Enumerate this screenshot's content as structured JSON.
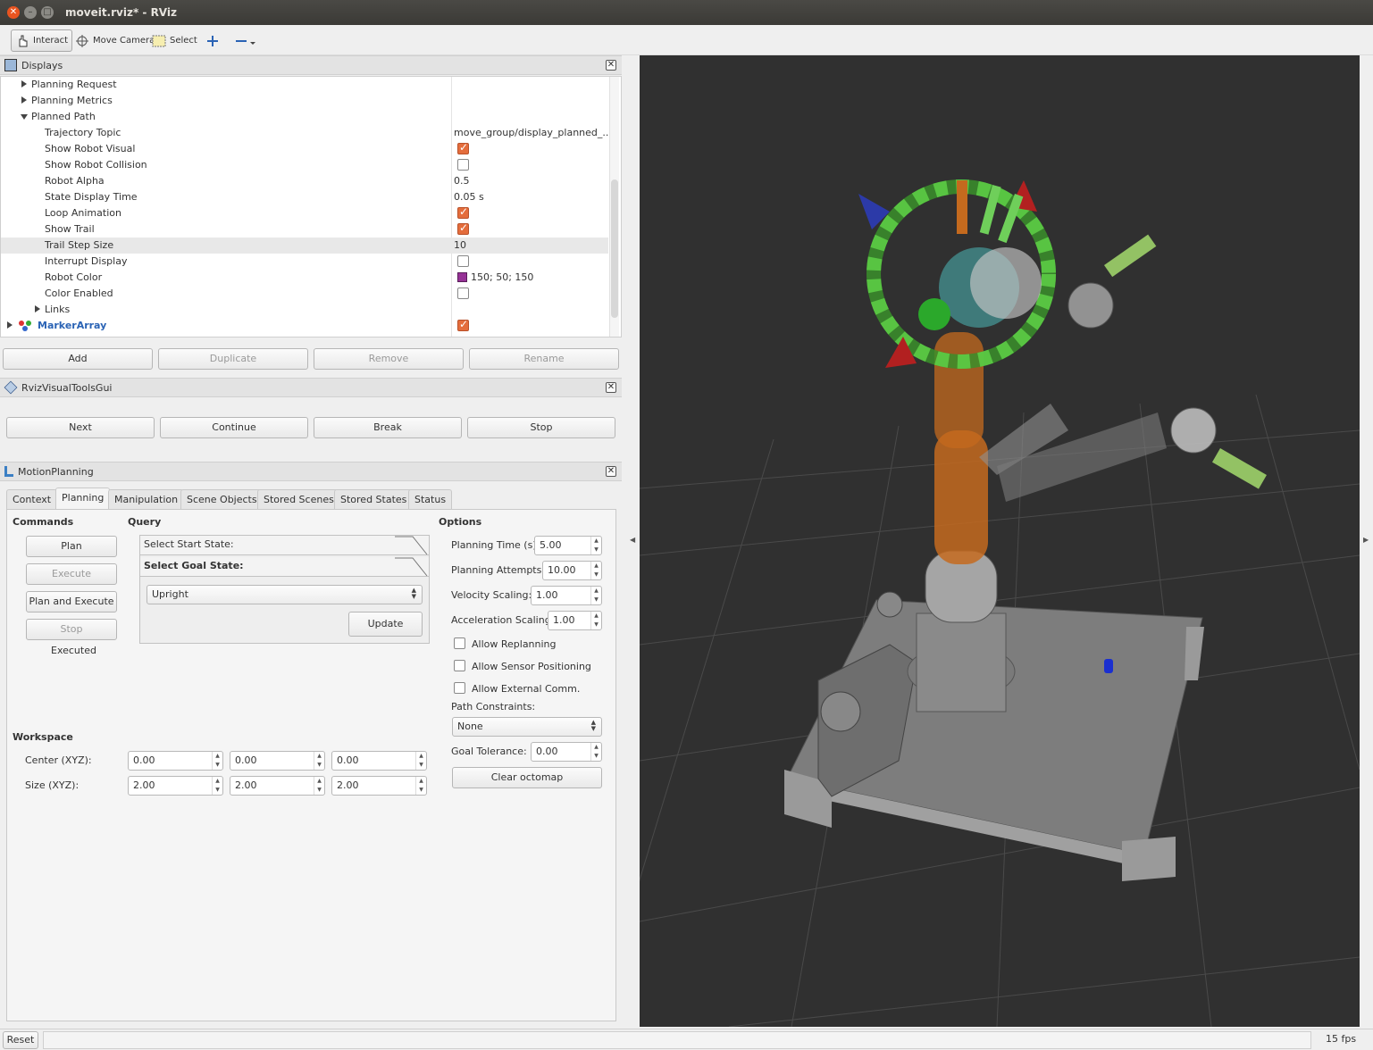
{
  "window": {
    "title": "moveit.rviz* - RViz"
  },
  "toolbar": {
    "interact": "Interact",
    "move_camera": "Move Camera",
    "select": "Select"
  },
  "displays": {
    "title": "Displays",
    "rows": [
      {
        "label": "Planning Request",
        "value": ""
      },
      {
        "label": "Planning Metrics",
        "value": ""
      },
      {
        "label": "Planned Path",
        "value": ""
      },
      {
        "label": "Trajectory Topic",
        "value": "move_group/display_planned_..."
      },
      {
        "label": "Show Robot Visual",
        "value": ""
      },
      {
        "label": "Show Robot Collision",
        "value": ""
      },
      {
        "label": "Robot Alpha",
        "value": "0.5"
      },
      {
        "label": "State Display Time",
        "value": "0.05 s"
      },
      {
        "label": "Loop Animation",
        "value": ""
      },
      {
        "label": "Show Trail",
        "value": ""
      },
      {
        "label": "Trail Step Size",
        "value": "10"
      },
      {
        "label": "Interrupt Display",
        "value": ""
      },
      {
        "label": "Robot Color",
        "value": "150; 50; 150"
      },
      {
        "label": "Color Enabled",
        "value": ""
      },
      {
        "label": "Links",
        "value": ""
      },
      {
        "label": "MarkerArray",
        "value": ""
      }
    ],
    "robot_color_hex": "#963296",
    "buttons": {
      "add": "Add",
      "duplicate": "Duplicate",
      "remove": "Remove",
      "rename": "Rename"
    }
  },
  "rvt": {
    "title": "RvizVisualToolsGui",
    "buttons": {
      "next": "Next",
      "continue": "Continue",
      "break": "Break",
      "stop": "Stop"
    }
  },
  "motion": {
    "title": "MotionPlanning",
    "tabs": [
      "Context",
      "Planning",
      "Manipulation",
      "Scene Objects",
      "Stored Scenes",
      "Stored States",
      "Status"
    ],
    "commands": {
      "heading": "Commands",
      "plan": "Plan",
      "execute": "Execute",
      "plan_execute": "Plan and Execute",
      "stop": "Stop",
      "status": "Executed"
    },
    "query": {
      "heading": "Query",
      "start": "Select Start State:",
      "goal": "Select Goal State:",
      "goal_value": "Upright",
      "update": "Update"
    },
    "options": {
      "heading": "Options",
      "planning_time_label": "Planning Time (s):",
      "planning_time": "5.00",
      "attempts_label": "Planning Attempts:",
      "attempts": "10.00",
      "velocity_label": "Velocity Scaling:",
      "velocity": "1.00",
      "accel_label": "Acceleration Scaling:",
      "accel": "1.00",
      "replanning": "Allow Replanning",
      "sensor": "Allow Sensor Positioning",
      "external": "Allow External Comm.",
      "constraints_label": "Path Constraints:",
      "constraints": "None",
      "tolerance_label": "Goal Tolerance:",
      "tolerance": "0.00",
      "clear": "Clear octomap"
    },
    "workspace": {
      "heading": "Workspace",
      "center_label": "Center (XYZ):",
      "center": [
        "0.00",
        "0.00",
        "0.00"
      ],
      "size_label": "Size (XYZ):",
      "size": [
        "2.00",
        "2.00",
        "2.00"
      ]
    }
  },
  "status": {
    "reset": "Reset",
    "fps": "15 fps"
  }
}
